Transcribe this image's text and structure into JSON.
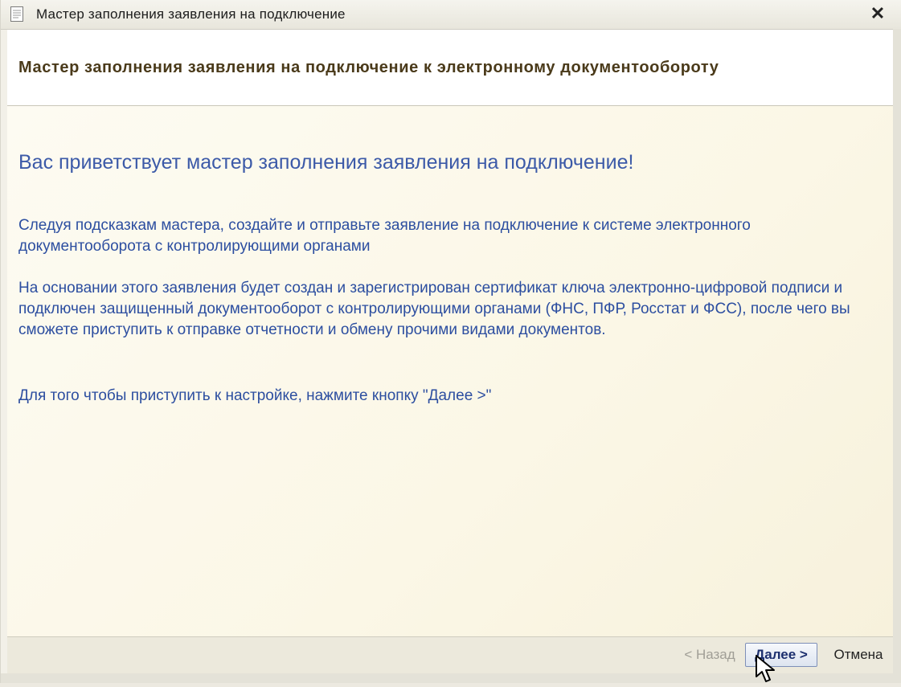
{
  "window": {
    "title": "Мастер заполнения заявления на подключение",
    "close_label": "✕"
  },
  "header": {
    "title": "Мастер заполнения заявления на подключение к электронному документообороту"
  },
  "main": {
    "welcome": "Вас приветствует мастер заполнения заявления на подключение!",
    "paragraph1": "Следуя подсказкам мастера, создайте и отправьте заявление на подключение к системе электронного документооборота с контролирующими органами",
    "paragraph2": "На основании этого заявления будет создан и зарегистрирован сертификат ключа электронно-цифровой подписи и подключен защищенный документооборот с контролирующими органами (ФНС, ПФР, Росстат и ФСС), после чего вы сможете приступить к отправке отчетности и обмену прочими видами документов.",
    "paragraph3": "Для того чтобы приступить к настройке, нажмите кнопку \"Далее >\""
  },
  "footer": {
    "back_label": "< Назад",
    "next_label": "Далее >",
    "cancel_label": "Отмена"
  },
  "colors": {
    "text_blue": "#2c4ea0",
    "header_brown": "#4a3a1a",
    "content_bg": "#fbf7e6"
  }
}
